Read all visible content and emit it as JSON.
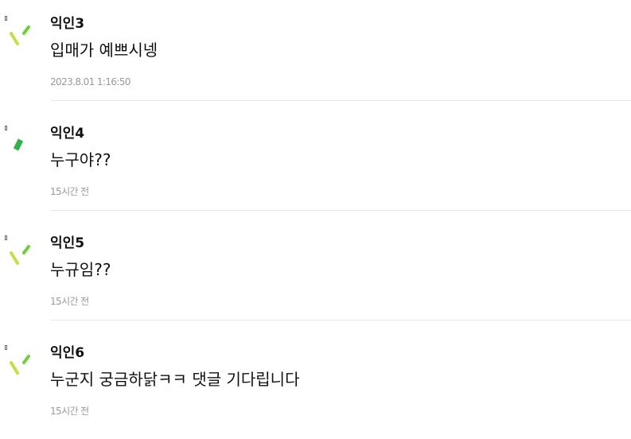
{
  "comments": [
    {
      "author": "익인3",
      "text": "입매가 예쁘시넹",
      "time": "2023.8.01 1:16:50",
      "avatar_icon": "two-strokes-icon",
      "avatar_colors": [
        "#c8dc46",
        "#6ed13c"
      ]
    },
    {
      "author": "익인4",
      "text": "누구야??",
      "time": "15시간 전",
      "avatar_icon": "single-stroke-icon",
      "avatar_colors": [
        "#2fb14c"
      ]
    },
    {
      "author": "익인5",
      "text": "누규임??",
      "time": "15시간 전",
      "avatar_icon": "two-strokes-icon",
      "avatar_colors": [
        "#c8dc46",
        "#6ed13c"
      ]
    },
    {
      "author": "익인6",
      "text": "누군지 궁금하닭ㅋㅋ 댓글 기다립니다",
      "time": "15시간 전",
      "avatar_icon": "two-strokes-icon",
      "avatar_colors": [
        "#c8dc46",
        "#6ed13c"
      ]
    }
  ]
}
